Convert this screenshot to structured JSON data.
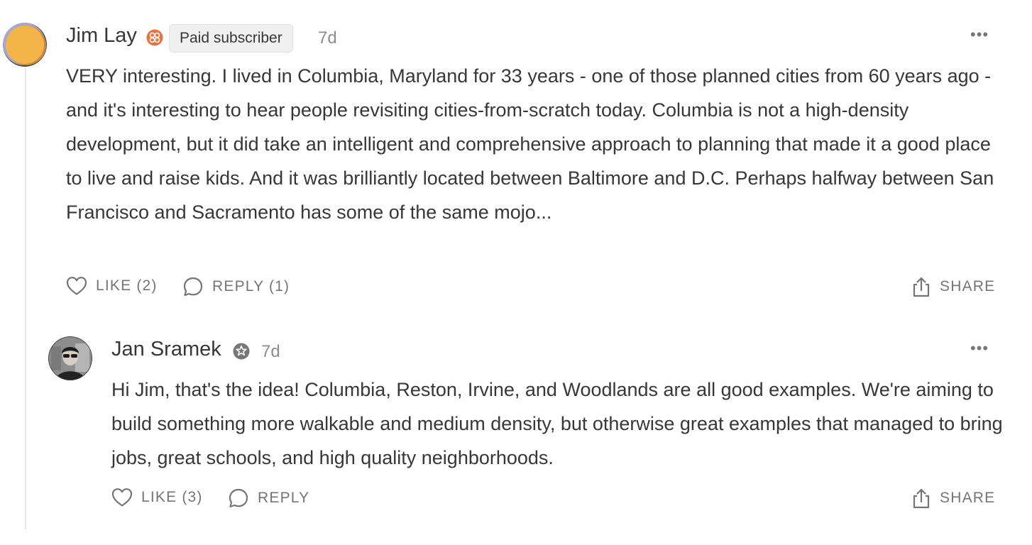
{
  "comments": [
    {
      "author": "Jim Lay",
      "badge": "Paid subscriber",
      "time": "7d",
      "text": "VERY interesting. I lived in Columbia, Maryland for 33 years - one of those planned cities from 60 years ago - and it's interesting to hear people revisiting cities-from-scratch today. Columbia is not a high-density development, but it did take an intelligent and comprehensive approach to planning that made it a good place to live and raise kids. And it was brilliantly located between Baltimore and D.C. Perhaps halfway between San Francisco and Sacramento has some of the same mojo...",
      "like_label": "LIKE (2)",
      "reply_label": "REPLY (1)",
      "share_label": "SHARE",
      "more_label": "•••"
    },
    {
      "author": "Jan Sramek",
      "time": "7d",
      "text": "Hi Jim, that's the idea! Columbia, Reston, Irvine, and Woodlands are all good examples. We're aiming to build something more walkable and medium density, but otherwise great examples that managed to bring jobs, great schools, and high quality neighborhoods.",
      "like_label": "LIKE (3)",
      "reply_label": "REPLY",
      "share_label": "SHARE",
      "more_label": "•••"
    }
  ],
  "colors": {
    "text": "#363737",
    "muted": "#757575",
    "badge_icon": "#e8743b",
    "thread_line": "#e6e6e6"
  },
  "icons": [
    "heart-icon",
    "comment-icon",
    "share-icon",
    "more-icon",
    "subscriber-badge-icon",
    "author-badge-icon"
  ]
}
